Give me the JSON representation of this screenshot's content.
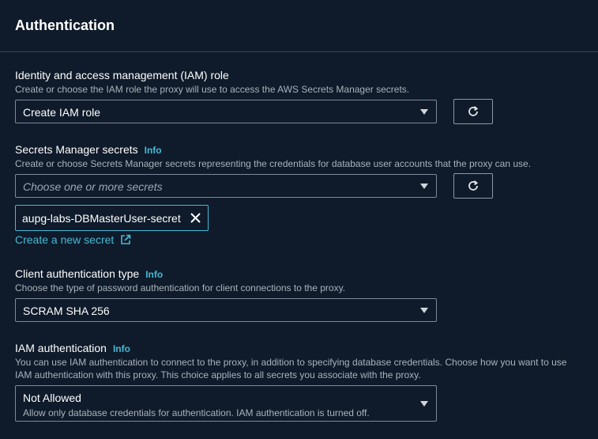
{
  "panel": {
    "title": "Authentication"
  },
  "iam_role": {
    "label": "Identity and access management (IAM) role",
    "description": "Create or choose the IAM role the proxy will use to access the AWS Secrets Manager secrets.",
    "value": "Create IAM role"
  },
  "secrets": {
    "label": "Secrets Manager secrets",
    "info": "Info",
    "description": "Create or choose Secrets Manager secrets representing the credentials for database user accounts that the proxy can use.",
    "placeholder": "Choose one or more secrets",
    "selected": [
      "aupg-labs-DBMasterUser-secret"
    ],
    "create_link": "Create a new secret"
  },
  "client_auth": {
    "label": "Client authentication type",
    "info": "Info",
    "description": "Choose the type of password authentication for client connections to the proxy.",
    "value": "SCRAM SHA 256"
  },
  "iam_auth": {
    "label": "IAM authentication",
    "info": "Info",
    "description_line1": "You can use IAM authentication to connect to the proxy, in addition to specifying database credentials. Choose how you want to use",
    "description_line2": "IAM authentication with this proxy. This choice applies to all secrets you associate with the proxy.",
    "value": "Not Allowed",
    "value_description": "Allow only database credentials for authentication. IAM authentication is turned off."
  },
  "colors": {
    "accent": "#44b9d6",
    "background": "#0f1b2a",
    "border": "#7d8998"
  },
  "icons": {
    "refresh": "refresh-icon",
    "caret": "caret-down-icon",
    "remove": "close-icon",
    "external": "external-link-icon"
  }
}
